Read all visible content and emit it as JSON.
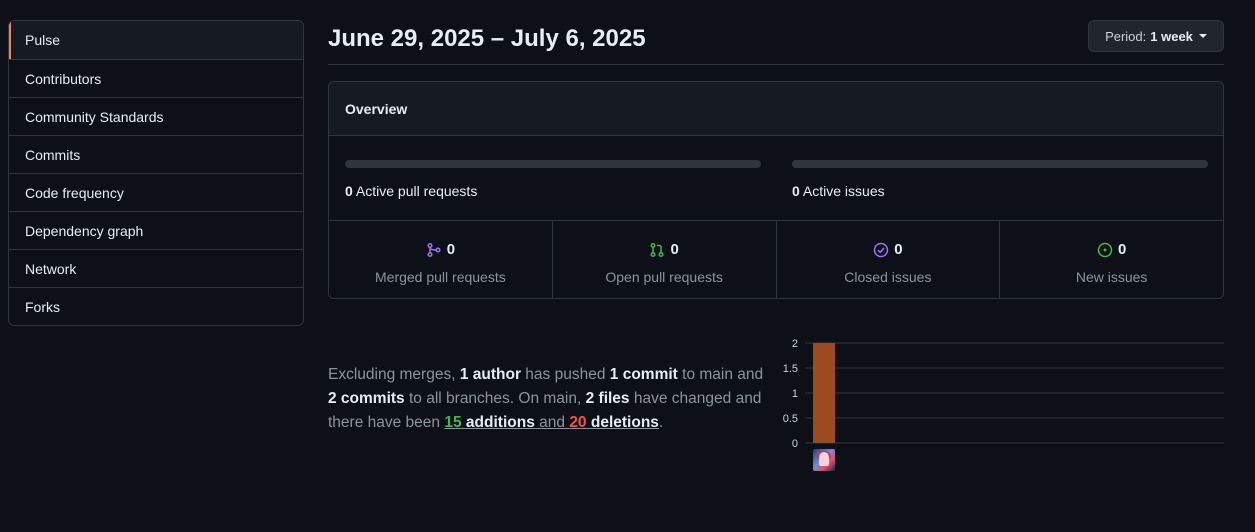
{
  "sidebar": {
    "items": [
      {
        "label": "Pulse",
        "active": true
      },
      {
        "label": "Contributors"
      },
      {
        "label": "Community Standards"
      },
      {
        "label": "Commits"
      },
      {
        "label": "Code frequency"
      },
      {
        "label": "Dependency graph"
      },
      {
        "label": "Network"
      },
      {
        "label": "Forks"
      }
    ]
  },
  "header": {
    "date_range": "June 29, 2025 – July 6, 2025",
    "period_prefix": "Period:",
    "period_value": "1 week"
  },
  "overview": {
    "title": "Overview",
    "active_prs": {
      "count": "0",
      "label": "Active pull requests"
    },
    "active_issues": {
      "count": "0",
      "label": "Active issues"
    },
    "stats": [
      {
        "icon": "merge-icon",
        "count": "0",
        "label": "Merged pull requests",
        "color": "#a371f7"
      },
      {
        "icon": "pull-request-icon",
        "count": "0",
        "label": "Open pull requests",
        "color": "#3fb950"
      },
      {
        "icon": "issue-closed-icon",
        "count": "0",
        "label": "Closed issues",
        "color": "#a371f7"
      },
      {
        "icon": "issue-opened-icon",
        "count": "0",
        "label": "New issues",
        "color": "#3fb950"
      }
    ]
  },
  "summary": {
    "p1": "Excluding merges,",
    "authors": "1 author",
    "p2": "has pushed",
    "commits_main": "1 commit",
    "p3": "to main and",
    "commits_all": "2 commits",
    "p4": "to all branches. On main,",
    "files": "2 files",
    "p5": "have changed and there have been",
    "additions_n": "15",
    "additions_w": "additions",
    "and": "and",
    "deletions_n": "20",
    "deletions_w": "deletions",
    "end": "."
  },
  "chart_data": {
    "type": "bar",
    "categories": [
      "author-1"
    ],
    "values": [
      2
    ],
    "ylim": [
      0,
      2
    ],
    "yticks": [
      "0",
      "0.5",
      "1",
      "1.5",
      "2"
    ],
    "grid": true,
    "bar_color": "#9a4a1e"
  },
  "colors": {
    "accent": "#f78166",
    "merged": "#a371f7",
    "open": "#3fb950",
    "additions": "#3fb950",
    "deletions": "#f85149"
  }
}
